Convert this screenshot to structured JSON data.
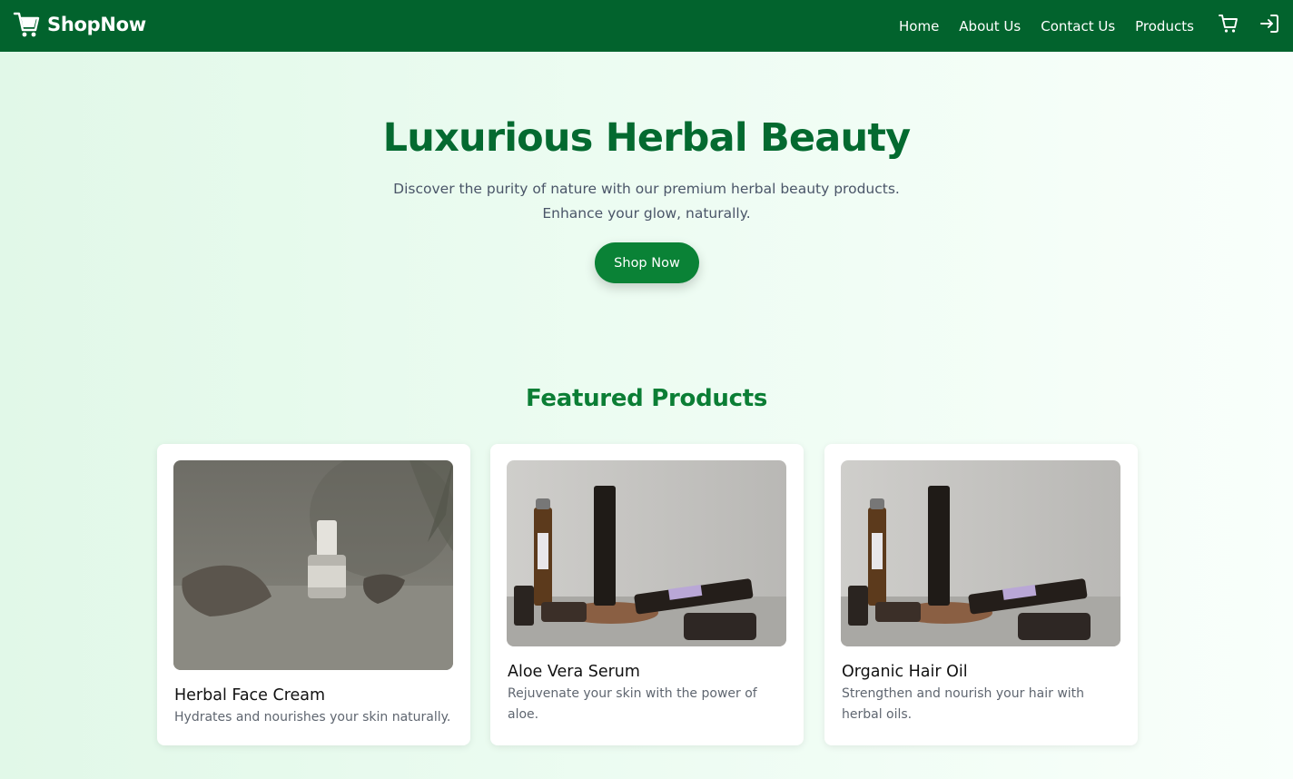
{
  "navbar": {
    "brand": "ShopNow",
    "brand_icon": "shopping-cart-icon",
    "links": [
      "Home",
      "About Us",
      "Contact Us",
      "Products"
    ],
    "icons": [
      "cart-icon",
      "login-icon"
    ],
    "background": "#02632d"
  },
  "hero": {
    "title": "Luxurious Herbal Beauty",
    "subtitle_line1": "Discover the purity of nature with our premium herbal beauty products.",
    "subtitle_line2": "Enhance your glow, naturally.",
    "button": "Shop Now"
  },
  "featured": {
    "title": "Featured Products",
    "products": [
      {
        "name": "Herbal Face Cream",
        "description": "Hydrates and nourishes your skin naturally."
      },
      {
        "name": "Aloe Vera Serum",
        "description": "Rejuvenate your skin with the power of aloe."
      },
      {
        "name": "Organic Hair Oil",
        "description": "Strengthen and nourish your hair with herbal oils."
      }
    ]
  },
  "colors": {
    "primary": "#02632d",
    "accent": "#0a8236",
    "title": "#046a30"
  }
}
